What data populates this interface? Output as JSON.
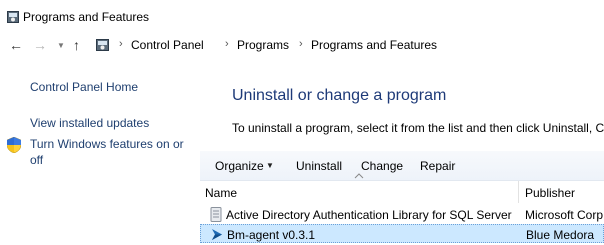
{
  "window": {
    "title": "Programs and Features"
  },
  "addressbar": {
    "breadcrumbs": [
      "Control Panel",
      "Programs",
      "Programs and Features"
    ]
  },
  "sidebar": {
    "home": "Control Panel Home",
    "links": [
      "View installed updates",
      "Turn Windows features on or",
      "off"
    ]
  },
  "main": {
    "heading": "Uninstall or change a program",
    "description": "To uninstall a program, select it from the list and then click Uninstall, C"
  },
  "toolbar": {
    "organize": "Organize",
    "uninstall": "Uninstall",
    "change": "Change",
    "repair": "Repair"
  },
  "table": {
    "columns": [
      "Name",
      "Publisher"
    ],
    "rows": [
      {
        "name": "Active Directory Authentication Library for SQL Server",
        "publisher": "Microsoft Corp",
        "icon": "installer-icon",
        "selected": false
      },
      {
        "name": "Bm-agent v0.3.1",
        "publisher": "Blue Medora",
        "icon": "bm-agent-icon",
        "selected": true
      }
    ]
  },
  "colors": {
    "link": "#1f3f6f",
    "heading": "#1e3a78",
    "selection": "#cce8ff"
  }
}
